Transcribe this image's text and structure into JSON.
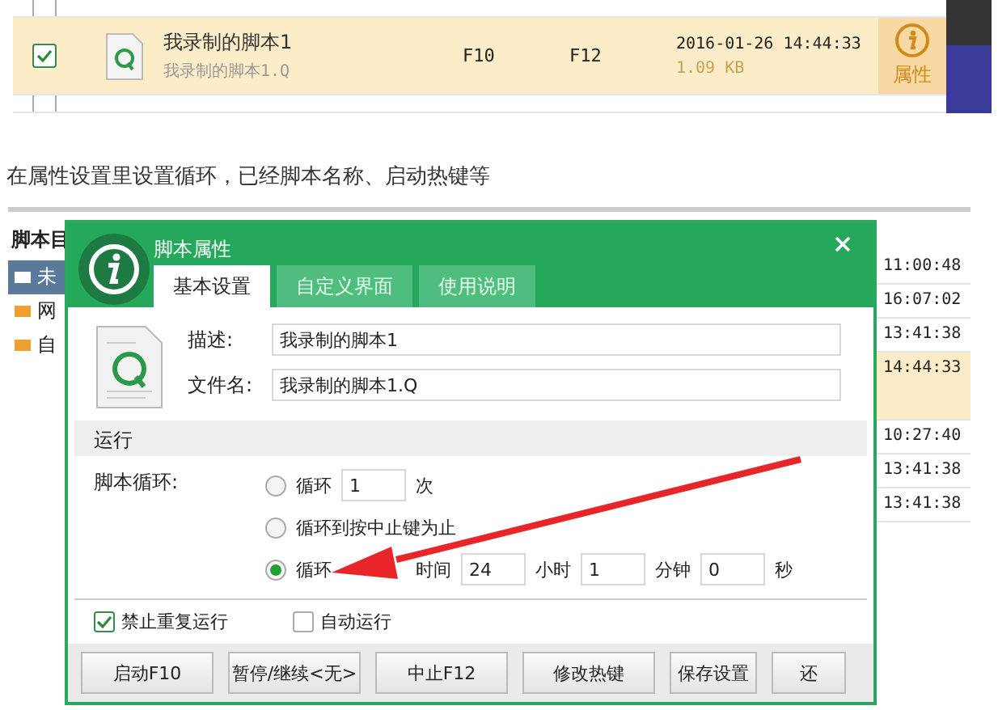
{
  "top_list": {
    "rows": [
      {
        "checked": false,
        "selected": false
      },
      {
        "checked": true,
        "selected": true,
        "name": "我录制的脚本1",
        "file": "我录制的脚本1.Q",
        "start_key": "F10",
        "stop_key": "F12",
        "date": "2016-01-26 14:44:33",
        "size": "1.09 KB"
      },
      {
        "checked": false,
        "selected": false
      }
    ],
    "property_label": "属性"
  },
  "caption": "在属性设置里设置循环，已经脚本名称、启动热键等",
  "app": {
    "sidebar": {
      "title": "脚本目",
      "items": [
        {
          "label": "未",
          "selected": true
        },
        {
          "label": "网",
          "selected": false
        },
        {
          "label": "自",
          "selected": false
        }
      ]
    },
    "times": [
      {
        "time": "11:00:48",
        "selected": false
      },
      {
        "time": "16:07:02",
        "selected": false
      },
      {
        "time": "13:41:38",
        "selected": false
      },
      {
        "time": "14:44:33",
        "selected": true
      },
      {
        "time": "10:27:40",
        "selected": false
      },
      {
        "time": "13:41:38",
        "selected": false
      },
      {
        "time": "13:41:38",
        "selected": false
      }
    ]
  },
  "dialog": {
    "title": "脚本属性",
    "tabs": [
      {
        "label": "基本设置",
        "selected": true
      },
      {
        "label": "自定义界面",
        "selected": false
      },
      {
        "label": "使用说明",
        "selected": false
      }
    ],
    "description_label": "描述:",
    "description": "我录制的脚本1",
    "filename_label": "文件名:",
    "filename": "我录制的脚本1.Q",
    "section": "运行",
    "loop_label": "脚本循环:",
    "loop_count": {
      "selected": false,
      "label": "循环",
      "value": "1",
      "unit": "次"
    },
    "loop_until_stop": {
      "selected": false,
      "label": "循环到按中止键为止"
    },
    "loop_time": {
      "selected": true,
      "label": "循环",
      "label_2": "时间",
      "hours": "24",
      "hours_unit": "小时",
      "minutes": "1",
      "minutes_unit": "分钟",
      "seconds": "0",
      "seconds_unit": "秒"
    },
    "checkboxes": [
      {
        "label": "禁止重复运行",
        "checked": true
      },
      {
        "label": "自动运行",
        "checked": false
      }
    ],
    "buttons": [
      "启动F10",
      "暂停/继续<无>",
      "中止F12",
      "修改热键",
      "保存设置",
      "还"
    ]
  }
}
